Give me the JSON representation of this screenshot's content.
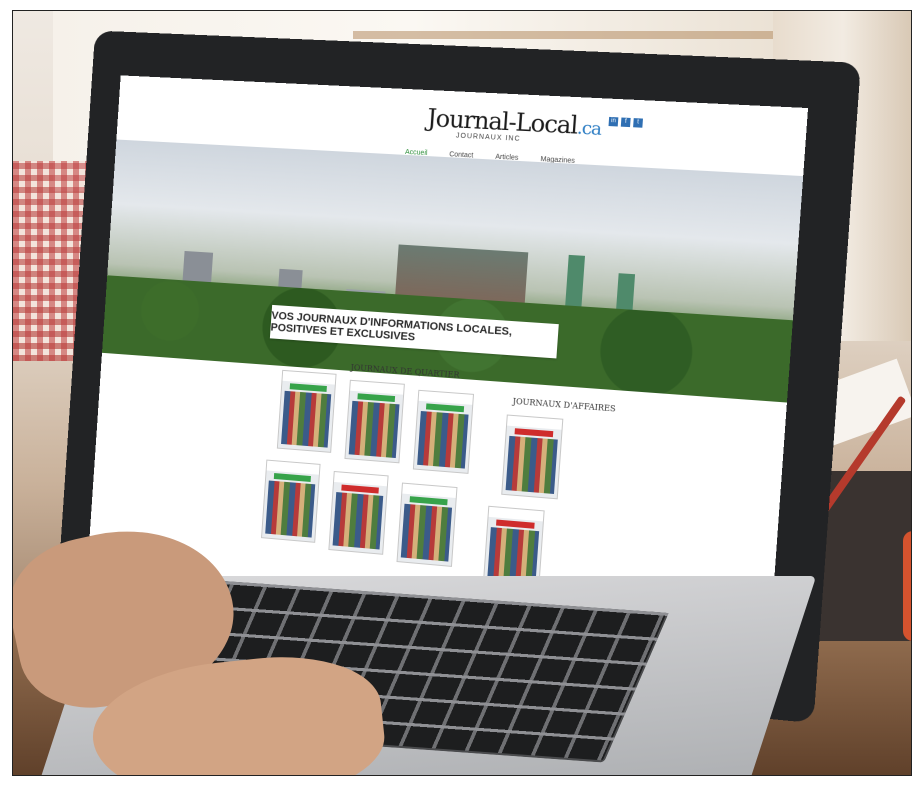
{
  "site": {
    "logo_main": "Journal-Local",
    "logo_suffix": ".ca",
    "logo_sub": "JOURNAUX INC",
    "social": [
      "in",
      "f",
      "t"
    ],
    "nav": [
      {
        "label": "Accueil",
        "active": true
      },
      {
        "label": "Contact",
        "active": false
      },
      {
        "label": "Articles",
        "active": false
      },
      {
        "label": "Magazines",
        "active": false
      }
    ],
    "banner": "VOS JOURNAUX D'INFORMATIONS LOCALES, POSITIVES ET EXCLUSIVES",
    "sections": {
      "quartier_title": "JOURNAUX DE QUARTIER",
      "affaires_title": "JOURNAUX D'AFFAIRES"
    }
  },
  "colors": {
    "accent_green": "#2a8d37",
    "accent_blue": "#2b7cc3",
    "badge_red": "#cf2c2c"
  }
}
